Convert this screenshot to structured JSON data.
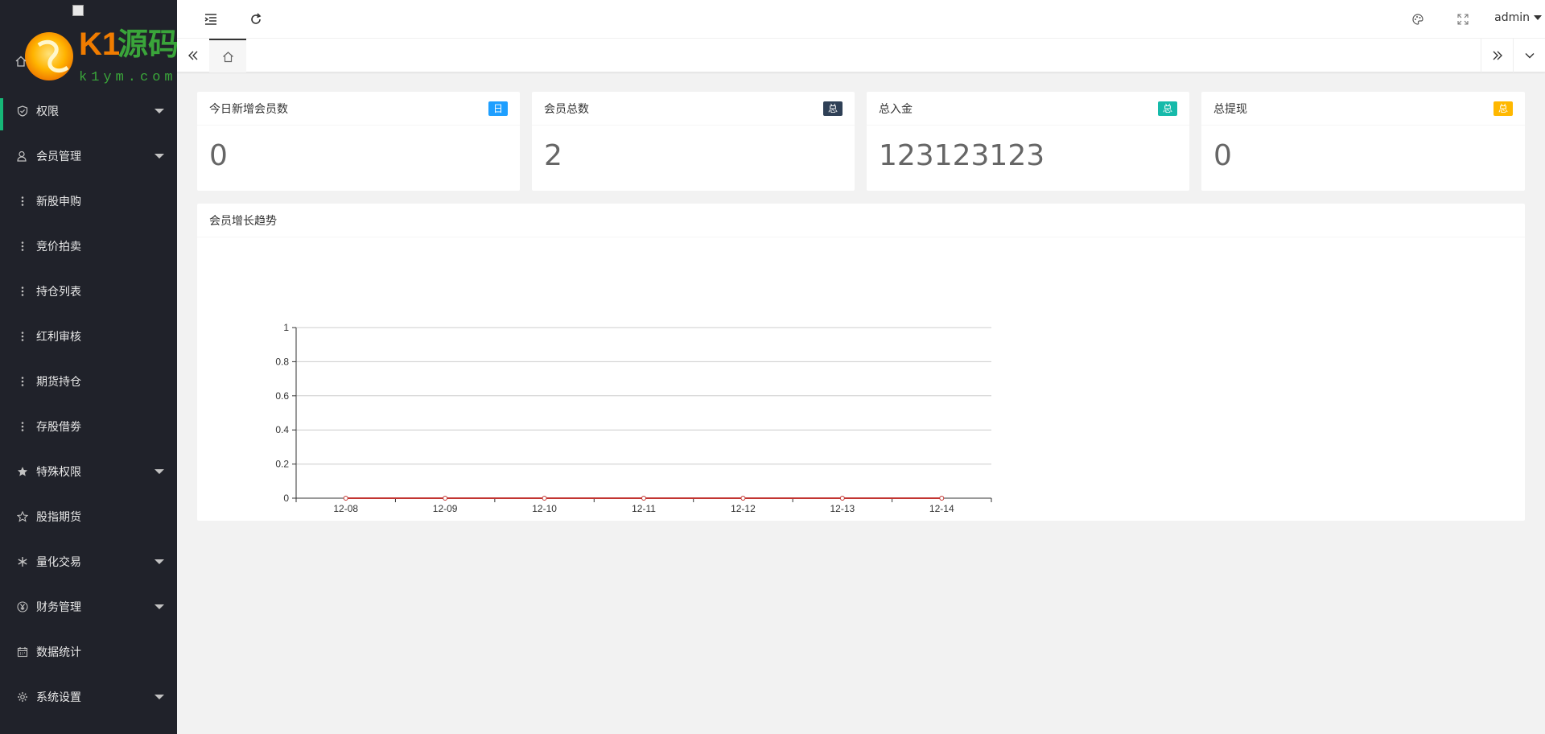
{
  "sidebar": {
    "items": [
      {
        "label": "权限",
        "icon": "shield-check-icon",
        "has_children": true
      },
      {
        "label": "会员管理",
        "icon": "user-icon",
        "has_children": true
      },
      {
        "label": "新股申购",
        "icon": "more-vertical-icon",
        "has_children": false
      },
      {
        "label": "竞价拍卖",
        "icon": "more-vertical-icon",
        "has_children": false
      },
      {
        "label": "持仓列表",
        "icon": "more-vertical-icon",
        "has_children": false
      },
      {
        "label": "红利审核",
        "icon": "more-vertical-icon",
        "has_children": false
      },
      {
        "label": "期货持仓",
        "icon": "more-vertical-icon",
        "has_children": false
      },
      {
        "label": "存股借劵",
        "icon": "more-vertical-icon",
        "has_children": false
      },
      {
        "label": "特殊权限",
        "icon": "star-filled-icon",
        "has_children": true
      },
      {
        "label": "股指期货",
        "icon": "star-outline-icon",
        "has_children": false
      },
      {
        "label": "量化交易",
        "icon": "snowflake-icon",
        "has_children": true
      },
      {
        "label": "财务管理",
        "icon": "yen-icon",
        "has_children": true
      },
      {
        "label": "数据统计",
        "icon": "calendar-icon",
        "has_children": false
      },
      {
        "label": "系统设置",
        "icon": "gear-icon",
        "has_children": true
      }
    ]
  },
  "header": {
    "user": "admin"
  },
  "stats": [
    {
      "title": "今日新增会员数",
      "badge": "日",
      "badge_color": "#1e9fff",
      "value": "0"
    },
    {
      "title": "会员总数",
      "badge": "总",
      "badge_color": "#2f4056",
      "value": "2"
    },
    {
      "title": "总入金",
      "badge": "总",
      "badge_color": "#16baaa",
      "value": "123123123"
    },
    {
      "title": "总提现",
      "badge": "总",
      "badge_color": "#ffb800",
      "value": "0"
    }
  ],
  "chart_panel": {
    "title": "会员增长趋势"
  },
  "chart_data": {
    "type": "line",
    "title": "",
    "categories": [
      "12-08",
      "12-09",
      "12-10",
      "12-11",
      "12-12",
      "12-13",
      "12-14"
    ],
    "series": [
      {
        "values": [
          0,
          0,
          0,
          0,
          0,
          0,
          0
        ],
        "color": "#c23531"
      }
    ],
    "y_ticks": [
      "0",
      "0.2",
      "0.4",
      "0.6",
      "0.8",
      "1"
    ],
    "ylim": [
      0,
      1
    ],
    "grid": true
  }
}
